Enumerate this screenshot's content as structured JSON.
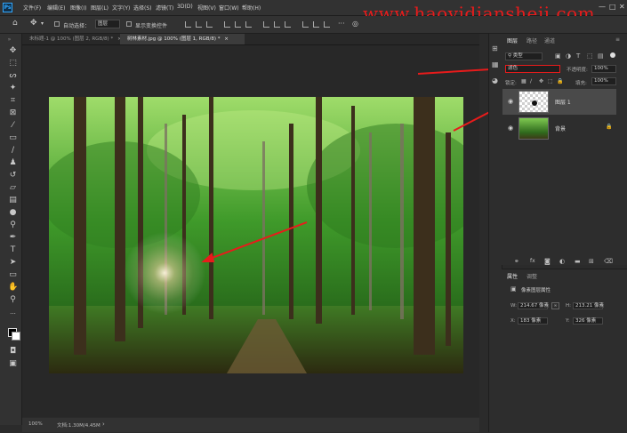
{
  "app": {
    "logo": "Ps"
  },
  "menu": [
    "文件(F)",
    "编辑(E)",
    "图像(I)",
    "图层(L)",
    "文字(Y)",
    "选择(S)",
    "滤镜(T)",
    "3D(D)",
    "视图(V)",
    "窗口(W)",
    "帮助(H)"
  ],
  "watermark": "www.haoyidiansheji.com",
  "window_controls": {
    "minimize": "—",
    "maximize": "□",
    "close": "✕"
  },
  "options": {
    "auto_select_label": "自动选择：",
    "auto_select_target": "图层",
    "show_transform_label": "显示变换控件"
  },
  "tabs": [
    {
      "label": "未标题-1 @ 100% (图层 2, RGB/8) *",
      "close": "×"
    },
    {
      "label": "树林素材.jpg @ 100% (图层 1, RGB/8) *",
      "close": "×"
    }
  ],
  "status": {
    "zoom": "100%",
    "doc": "文档:1.30M/4.45M"
  },
  "layers_panel": {
    "tabs": [
      "图层",
      "路径",
      "通道"
    ],
    "filter_kind": "类型",
    "blend_mode": "滤色",
    "opacity_label": "不透明度:",
    "opacity_value": "100%",
    "lock_label": "锁定:",
    "fill_label": "填充:",
    "fill_value": "100%",
    "layers": [
      {
        "name": "图层 1",
        "selected": true
      },
      {
        "name": "背景",
        "selected": false,
        "locked": true
      }
    ]
  },
  "properties_panel": {
    "tabs": [
      "属性",
      "调整"
    ],
    "title": "像素图层属性",
    "w_label": "W:",
    "w_value": "214.67 像素",
    "h_label": "H:",
    "h_value": "213.21 像素",
    "x_label": "X:",
    "x_value": "183 像素",
    "y_label": "Y:",
    "y_value": "326 像素",
    "link_icon": "link-icon"
  },
  "colors": {
    "accent": "#31a8ff",
    "annotation": "#e81b1b",
    "panel": "#2d2d2d",
    "canvas_bg": "#282828"
  }
}
